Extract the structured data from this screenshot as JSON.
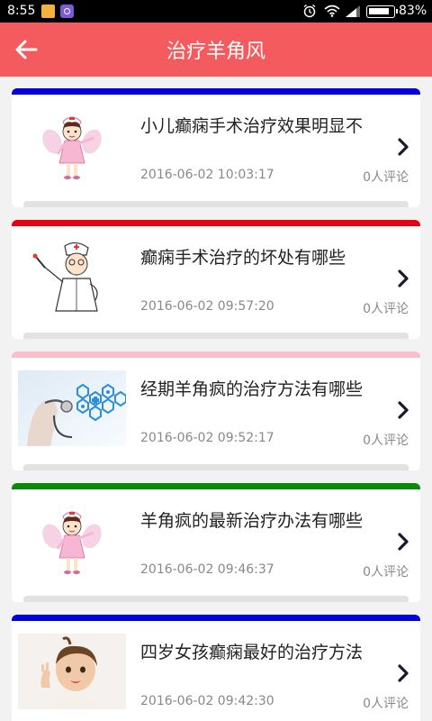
{
  "status_bar": {
    "time": "8:55",
    "battery": "83%"
  },
  "header": {
    "title": "治疗羊角风"
  },
  "articles": [
    {
      "title": "小儿癫痫手术治疗效果明显不",
      "date": "2016-06-02 10:03:17",
      "comments": "0人评论",
      "accent": "#0000dd",
      "thumbnail": "nurse-cartoon"
    },
    {
      "title": "癫痫手术治疗的坏处有哪些",
      "date": "2016-06-02 09:57:20",
      "comments": "0人评论",
      "accent": "#e60012",
      "thumbnail": "doctor-cartoon"
    },
    {
      "title": "经期羊角疯的治疗方法有哪些",
      "date": "2016-06-02 09:52:17",
      "comments": "0人评论",
      "accent": "#f9c0cb",
      "thumbnail": "stethoscope-medical-icons"
    },
    {
      "title": "羊角疯的最新治疗办法有哪些",
      "date": "2016-06-02 09:46:37",
      "comments": "0人评论",
      "accent": "#0a8a0a",
      "thumbnail": "nurse-cartoon"
    },
    {
      "title": "四岁女孩癫痫最好的治疗方法",
      "date": "2016-06-02 09:42:30",
      "comments": "0人评论",
      "accent": "#0000dd",
      "thumbnail": "child-photo"
    }
  ]
}
